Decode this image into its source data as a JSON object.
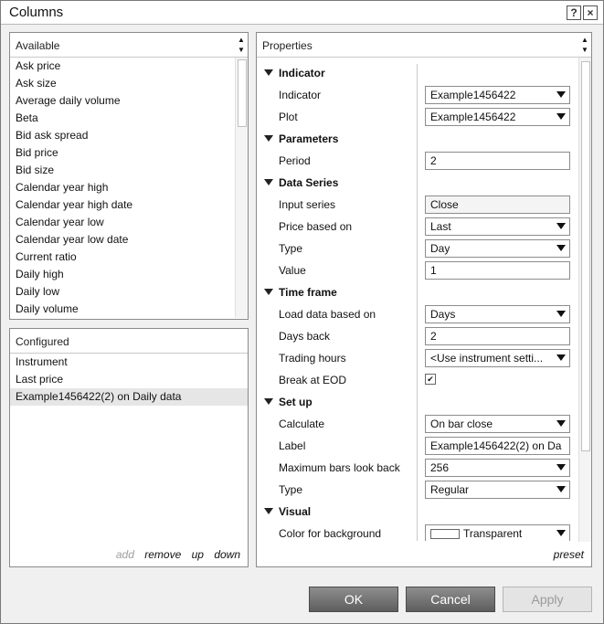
{
  "window": {
    "title": "Columns",
    "help_label": "?",
    "close_label": "×"
  },
  "available": {
    "header": "Available",
    "items": [
      "Ask price",
      "Ask size",
      "Average daily volume",
      "Beta",
      "Bid ask spread",
      "Bid price",
      "Bid size",
      "Calendar year high",
      "Calendar year high date",
      "Calendar year low",
      "Calendar year low date",
      "Current ratio",
      "Daily high",
      "Daily low",
      "Daily volume"
    ]
  },
  "configured": {
    "header": "Configured",
    "items": [
      "Instrument",
      "Last price",
      "Example1456422(2) on Daily data"
    ],
    "add_label": "add",
    "remove_label": "remove",
    "up_label": "up",
    "down_label": "down"
  },
  "properties": {
    "header": "Properties",
    "rows": [
      {
        "kind": "cat",
        "label": "Indicator"
      },
      {
        "kind": "select",
        "label": "Indicator",
        "value": "Example1456422"
      },
      {
        "kind": "select",
        "label": "Plot",
        "value": "Example1456422"
      },
      {
        "kind": "cat",
        "label": "Parameters"
      },
      {
        "kind": "input",
        "label": "Period",
        "value": "2"
      },
      {
        "kind": "cat",
        "label": "Data Series"
      },
      {
        "kind": "input",
        "label": "Input series",
        "value": "Close"
      },
      {
        "kind": "select",
        "label": "Price based on",
        "value": "Last"
      },
      {
        "kind": "select",
        "label": "Type",
        "value": "Day"
      },
      {
        "kind": "input",
        "label": "Value",
        "value": "1"
      },
      {
        "kind": "cat",
        "label": "Time frame"
      },
      {
        "kind": "select",
        "label": "Load data based on",
        "value": "Days"
      },
      {
        "kind": "input",
        "label": "Days back",
        "value": "2"
      },
      {
        "kind": "select",
        "label": "Trading hours",
        "value": "<Use instrument setti..."
      },
      {
        "kind": "check",
        "label": "Break at EOD",
        "value": "✔"
      },
      {
        "kind": "cat",
        "label": "Set up"
      },
      {
        "kind": "select",
        "label": "Calculate",
        "value": "On bar close"
      },
      {
        "kind": "input",
        "label": "Label",
        "value": "Example1456422(2) on Da"
      },
      {
        "kind": "select",
        "label": "Maximum bars look back",
        "value": "256"
      },
      {
        "kind": "select",
        "label": "Type",
        "value": "Regular"
      },
      {
        "kind": "cat",
        "label": "Visual"
      },
      {
        "kind": "color",
        "label": "Color for background",
        "value": "Transparent"
      }
    ],
    "preset_label": "preset"
  },
  "buttons": {
    "ok": "OK",
    "cancel": "Cancel",
    "apply": "Apply"
  },
  "colors": {
    "button_top": "#8e8e8e",
    "button_bottom": "#5e5e5e",
    "disabled_text": "#9a9a9a"
  }
}
